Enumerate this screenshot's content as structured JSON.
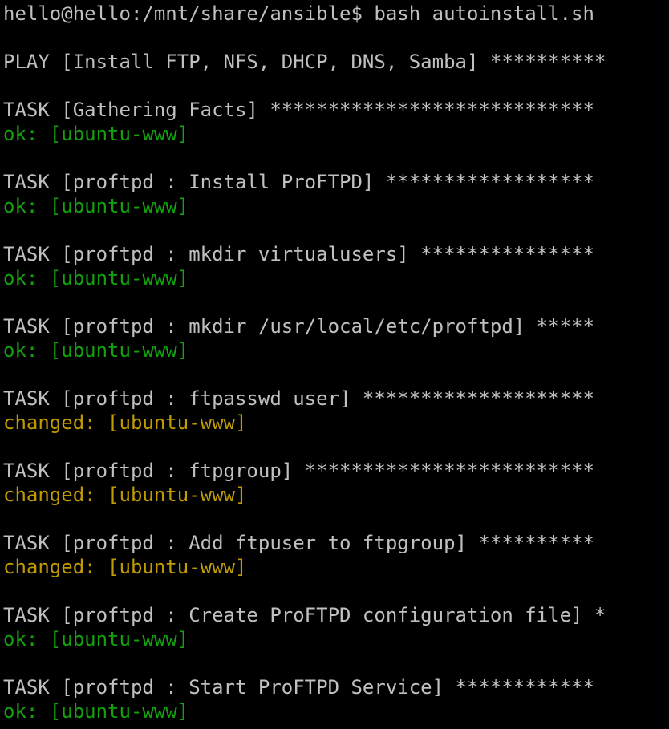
{
  "terminal": {
    "colors": {
      "background": "#000000",
      "text": "#c0c0c0",
      "ok": "#13a10e",
      "changed": "#c19c00"
    },
    "prompt_line": "hello@hello:/mnt/share/ansible$ bash autoinstall.sh",
    "play_header": "PLAY [Install FTP, NFS, DHCP, DNS, Samba] **********",
    "tasks": [
      {
        "header": "TASK [Gathering Facts] ****************************",
        "result": "ok: [ubuntu-www]"
      },
      {
        "header": "TASK [proftpd : Install ProFTPD] ******************",
        "result": "ok: [ubuntu-www]"
      },
      {
        "header": "TASK [proftpd : mkdir virtualusers] ***************",
        "result": "ok: [ubuntu-www]"
      },
      {
        "header": "TASK [proftpd : mkdir /usr/local/etc/proftpd] *****",
        "result": "ok: [ubuntu-www]"
      },
      {
        "header": "TASK [proftpd : ftpasswd user] ********************",
        "result": "changed: [ubuntu-www]"
      },
      {
        "header": "TASK [proftpd : ftpgroup] *************************",
        "result": "changed: [ubuntu-www]"
      },
      {
        "header": "TASK [proftpd : Add ftpuser to ftpgroup] **********",
        "result": "changed: [ubuntu-www]"
      },
      {
        "header": "TASK [proftpd : Create ProFTPD configuration file] *",
        "result": "ok: [ubuntu-www]"
      },
      {
        "header": "TASK [proftpd : Start ProFTPD Service] ************",
        "result": "ok: [ubuntu-www]"
      }
    ]
  }
}
